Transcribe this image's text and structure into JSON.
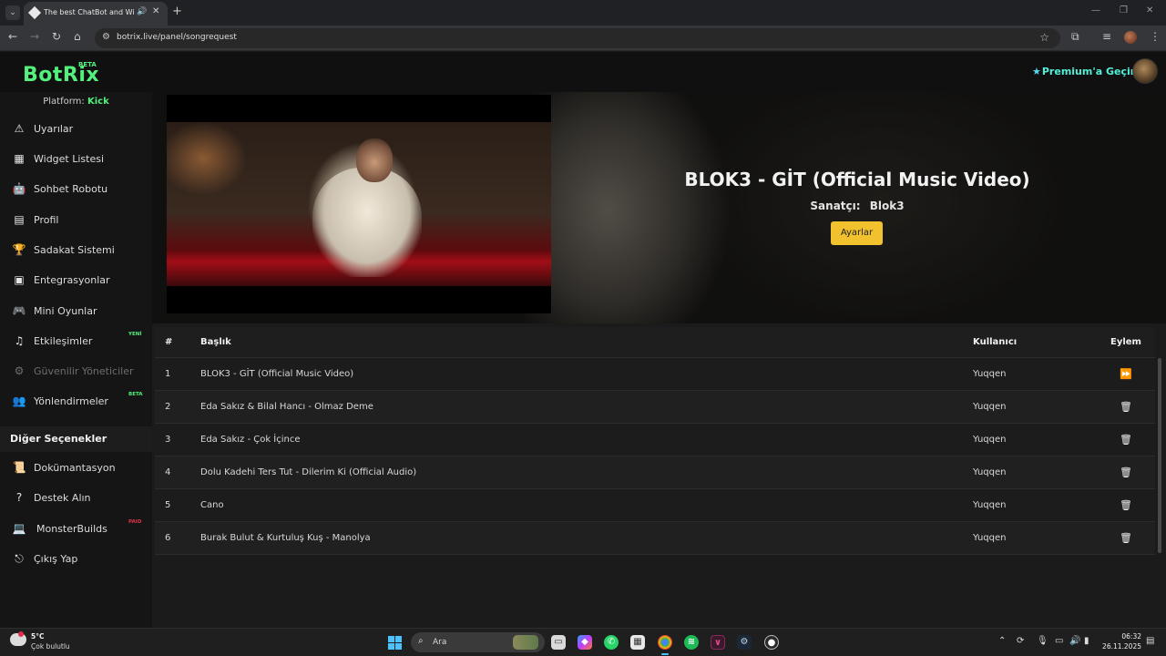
{
  "browser": {
    "tab_title": "The best ChatBot and Widg",
    "tab_audio_icon": "speaker-icon",
    "url": "botrix.live/panel/songrequest",
    "new_tab": "+",
    "min": "—",
    "max": "❐",
    "close": "✕"
  },
  "header": {
    "logo": "BotRix",
    "logo_badge": "BETA",
    "premium_label": "Premium'a Geçin",
    "premium_icon": "★"
  },
  "sidebar": {
    "platform_label": "Platform:",
    "platform_name": "Kick",
    "items": [
      {
        "label": "Uyarılar",
        "icon": "⚠",
        "icon_name": "warning-icon"
      },
      {
        "label": "Widget Listesi",
        "icon": "▦",
        "icon_name": "grid-icon"
      },
      {
        "label": "Sohbet Robotu",
        "icon": "🤖",
        "icon_name": "robot-icon"
      },
      {
        "label": "Profil",
        "icon": "▤",
        "icon_name": "id-card-icon"
      },
      {
        "label": "Sadakat Sistemi",
        "icon": "🏆",
        "icon_name": "trophy-icon"
      },
      {
        "label": "Entegrasyonlar",
        "icon": "▣",
        "icon_name": "integration-icon"
      },
      {
        "label": "Mini Oyunlar",
        "icon": "🎮",
        "icon_name": "gamepad-icon"
      },
      {
        "label": "Etkileşimler",
        "icon": "♫",
        "icon_name": "music-icon",
        "badge": "YENİ"
      },
      {
        "label": "Güvenilir Yöneticiler",
        "icon": "⚙",
        "icon_name": "users-gear-icon",
        "disabled": true
      },
      {
        "label": "Yönlendirmeler",
        "icon": "👥",
        "icon_name": "users-icon",
        "badge": "BETA"
      }
    ],
    "section_title": "Diğer Seçenekler",
    "other_items": [
      {
        "label": "Dokümantasyon",
        "icon": "📜",
        "icon_name": "scroll-icon"
      },
      {
        "label": "Destek Alın",
        "icon": "?",
        "icon_name": "question-icon"
      },
      {
        "label": "MonsterBuilds",
        "icon": "💻",
        "icon_name": "laptop-icon",
        "badge": "PAID"
      },
      {
        "label": "Çıkış Yap",
        "icon": "⎋",
        "icon_name": "logout-icon"
      }
    ]
  },
  "now_playing": {
    "title": "BLOK3 - GİT (Official Music Video)",
    "artist_label": "Sanatçı:",
    "artist": "Blok3",
    "settings_button": "Ayarlar"
  },
  "queue": {
    "headers": {
      "num": "#",
      "title": "Başlık",
      "user": "Kullanıcı",
      "action": "Eylem"
    },
    "rows": [
      {
        "num": "1",
        "title": "BLOK3 - GİT (Official Music Video)",
        "user": "Yuqqen",
        "action": "skip"
      },
      {
        "num": "2",
        "title": "Eda Sakız & Bilal Hancı - Olmaz Deme",
        "user": "Yuqqen",
        "action": "delete"
      },
      {
        "num": "3",
        "title": "Eda Sakız - Çok İçince",
        "user": "Yuqqen",
        "action": "delete"
      },
      {
        "num": "4",
        "title": "Dolu Kadehi Ters Tut - Dilerim Ki (Official Audio)",
        "user": "Yuqqen",
        "action": "delete"
      },
      {
        "num": "5",
        "title": "Cano",
        "user": "Yuqqen",
        "action": "delete"
      },
      {
        "num": "6",
        "title": "Burak Bulut & Kurtuluş Kuş - Manolya",
        "user": "Yuqqen",
        "action": "delete"
      }
    ]
  },
  "taskbar": {
    "temperature": "5°C",
    "weather": "Çok bulutlu",
    "search_label": "Ara",
    "time": "06:32",
    "date": "26.11.2025"
  },
  "colors": {
    "brand_green": "#53f07b",
    "premium_cyan": "#53f0d8",
    "settings_yellow": "#f2c12e"
  }
}
